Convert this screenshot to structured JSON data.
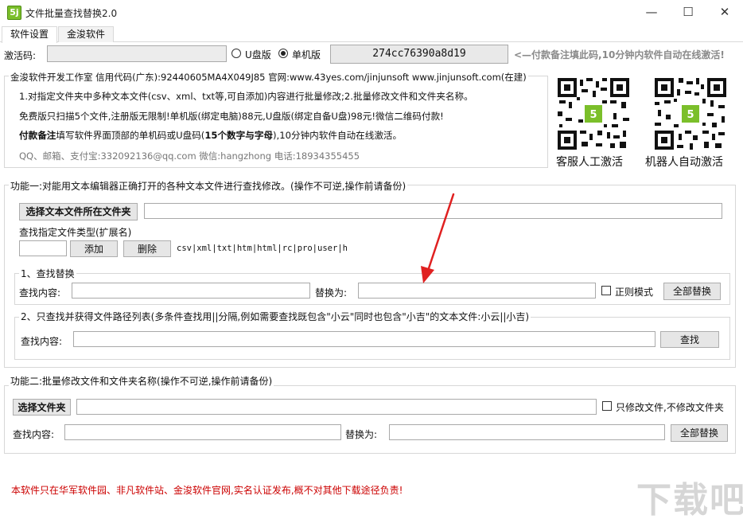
{
  "window": {
    "title": "文件批量查找替换2.0",
    "icon_text": "5j",
    "minimize_glyph": "—",
    "maximize_glyph": "☐",
    "close_glyph": "✕"
  },
  "tabs": [
    {
      "label": "软件设置",
      "active": true
    },
    {
      "label": "金浚软件",
      "active": false
    }
  ],
  "activation": {
    "label": "激活码:",
    "value": "",
    "radio_udisk": "U盘版",
    "radio_standalone": "单机版",
    "selected": "单机版",
    "machine_code": "274cc76390a8d19",
    "notice": "<—付款备注填此码,10分钟内软件自动在线激活!"
  },
  "info": {
    "legend": "金浚软件开发工作室 信用代码(广东):92440605MA4X049J85 官网:www.43yes.com/jinjunsoft  www.jinjunsoft.com(在建)",
    "line1": "1.对指定文件夹中多种文本文件(csv、xml、txt等,可自添加)内容进行批量修改;2.批量修改文件和文件夹名称。",
    "line2": "免费版只扫描5个文件,注册版无限制!单机版(绑定电脑)88元,U盘版(绑定自备U盘)98元!微信二维码付款!",
    "line3_bold": "付款备注",
    "line3_mid": "填写软件界面顶部的单机码或U盘码(",
    "line3_bold2": "15个数字与字母",
    "line3_end": "),10分钟内软件自动在线激活。",
    "contact": "QQ、邮箱、支付宝:332092136@qq.com     微信:hangzhong     电话:18934355455",
    "qr1_caption": "客服人工激活",
    "qr2_caption": "机器人自动激活"
  },
  "func1": {
    "legend": "功能一:对能用文本编辑器正确打开的各种文本文件进行查找修改。(操作不可逆,操作前请备份)",
    "select_folder_btn": "选择文本文件所在文件夹",
    "folder_path": "",
    "ext_label": "查找指定文件类型(扩展名)",
    "ext_value": "",
    "add_btn": "添加",
    "delete_btn": "删除",
    "ext_list": "csv|xml|txt|htm|html|rc|pro|user|h",
    "replace_group": {
      "legend": "1、查找替换",
      "find_label": "查找内容:",
      "find_value": "",
      "replace_label": "替换为:",
      "replace_value": "",
      "regex_label": "正则模式",
      "replace_all_btn": "全部替换"
    },
    "search_group": {
      "legend": "2、只查找并获得文件路径列表(多条件查找用||分隔,例如需要查找既包含\"小云\"同时也包含\"小吉\"的文本文件:小云||小吉)",
      "find_label": "查找内容:",
      "find_value": "",
      "search_btn": "查找"
    }
  },
  "func2": {
    "legend": "功能二:批量修改文件和文件夹名称(操作不可逆,操作前请备份)",
    "select_folder_btn": "选择文件夹",
    "folder_path": "",
    "files_only_label": "只修改文件,不修改文件夹",
    "find_label": "查找内容:",
    "find_value": "",
    "replace_label": "替换为:",
    "replace_value": "",
    "replace_all_btn": "全部替换"
  },
  "footer": {
    "notice": "本软件只在华军软件园、非凡软件站、金浚软件官网,实名认证发布,概不对其他下载途径负责!",
    "watermark": "下载吧"
  },
  "colors": {
    "accent_red": "#cc0000",
    "arrow_red": "#e02020",
    "icon_green": "#7bbf2a"
  }
}
